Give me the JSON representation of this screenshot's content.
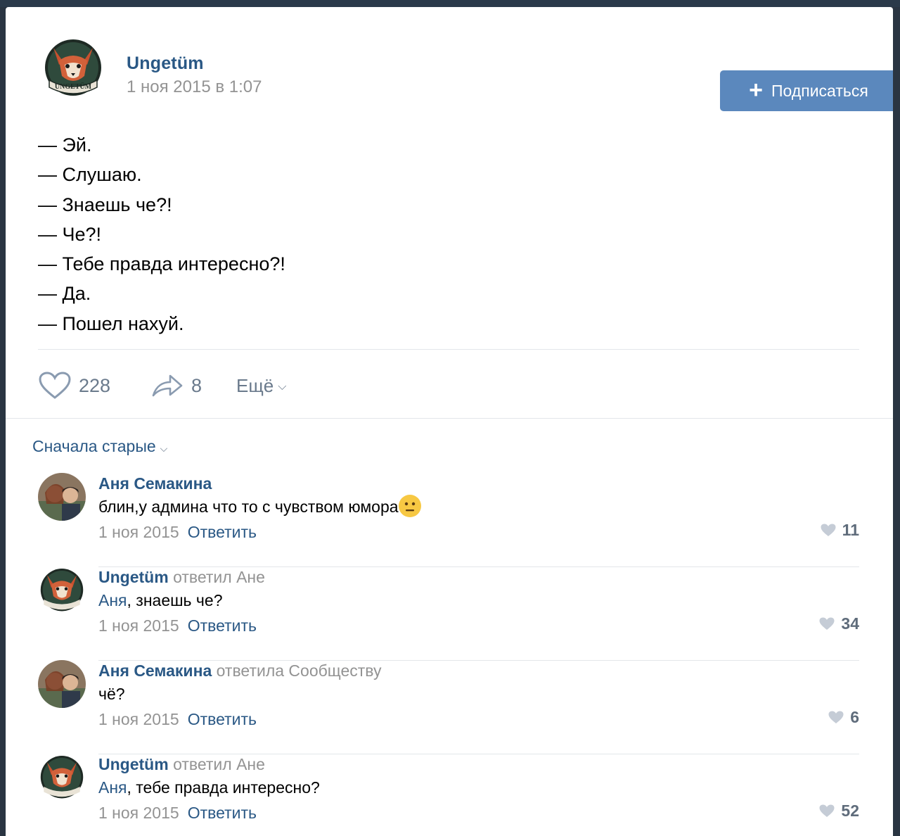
{
  "post": {
    "author": "Ungetüm",
    "date": "1 ноя 2015 в 1:07",
    "subscribe_label": "Подписаться",
    "avatar_text": "UNGETÜM",
    "lines": [
      "— Эй.",
      "— Слушаю.",
      "— Знаешь че?!",
      "— Че?!",
      "— Тебе правда интересно?!",
      "— Да.",
      "— Пошел нахуй."
    ],
    "likes": "228",
    "shares": "8",
    "more_label": "Ещё"
  },
  "comments_sort": "Сначала старые",
  "comments": [
    {
      "author": "Аня Семакина",
      "reply_to": "",
      "mention": "",
      "text": "блин,у админа что то с чувством юмора",
      "date": "1 ноя 2015",
      "reply_label": "Ответить",
      "likes": "11"
    },
    {
      "author": "Ungetüm",
      "reply_to": "ответил Ане",
      "mention": "Аня",
      "text": ", знаешь че?",
      "date": "1 ноя 2015",
      "reply_label": "Ответить",
      "likes": "34"
    },
    {
      "author": "Аня Семакина",
      "reply_to": "ответила Сообществу",
      "mention": "",
      "text": "чё?",
      "date": "1 ноя 2015",
      "reply_label": "Ответить",
      "likes": "6"
    },
    {
      "author": "Ungetüm",
      "reply_to": "ответил Ане",
      "mention": "Аня",
      "text": ", тебе правда интересно?",
      "date": "1 ноя 2015",
      "reply_label": "Ответить",
      "likes": "52"
    }
  ],
  "colors": {
    "link": "#2a5885",
    "button": "#5b88bd",
    "muted": "#939393"
  }
}
